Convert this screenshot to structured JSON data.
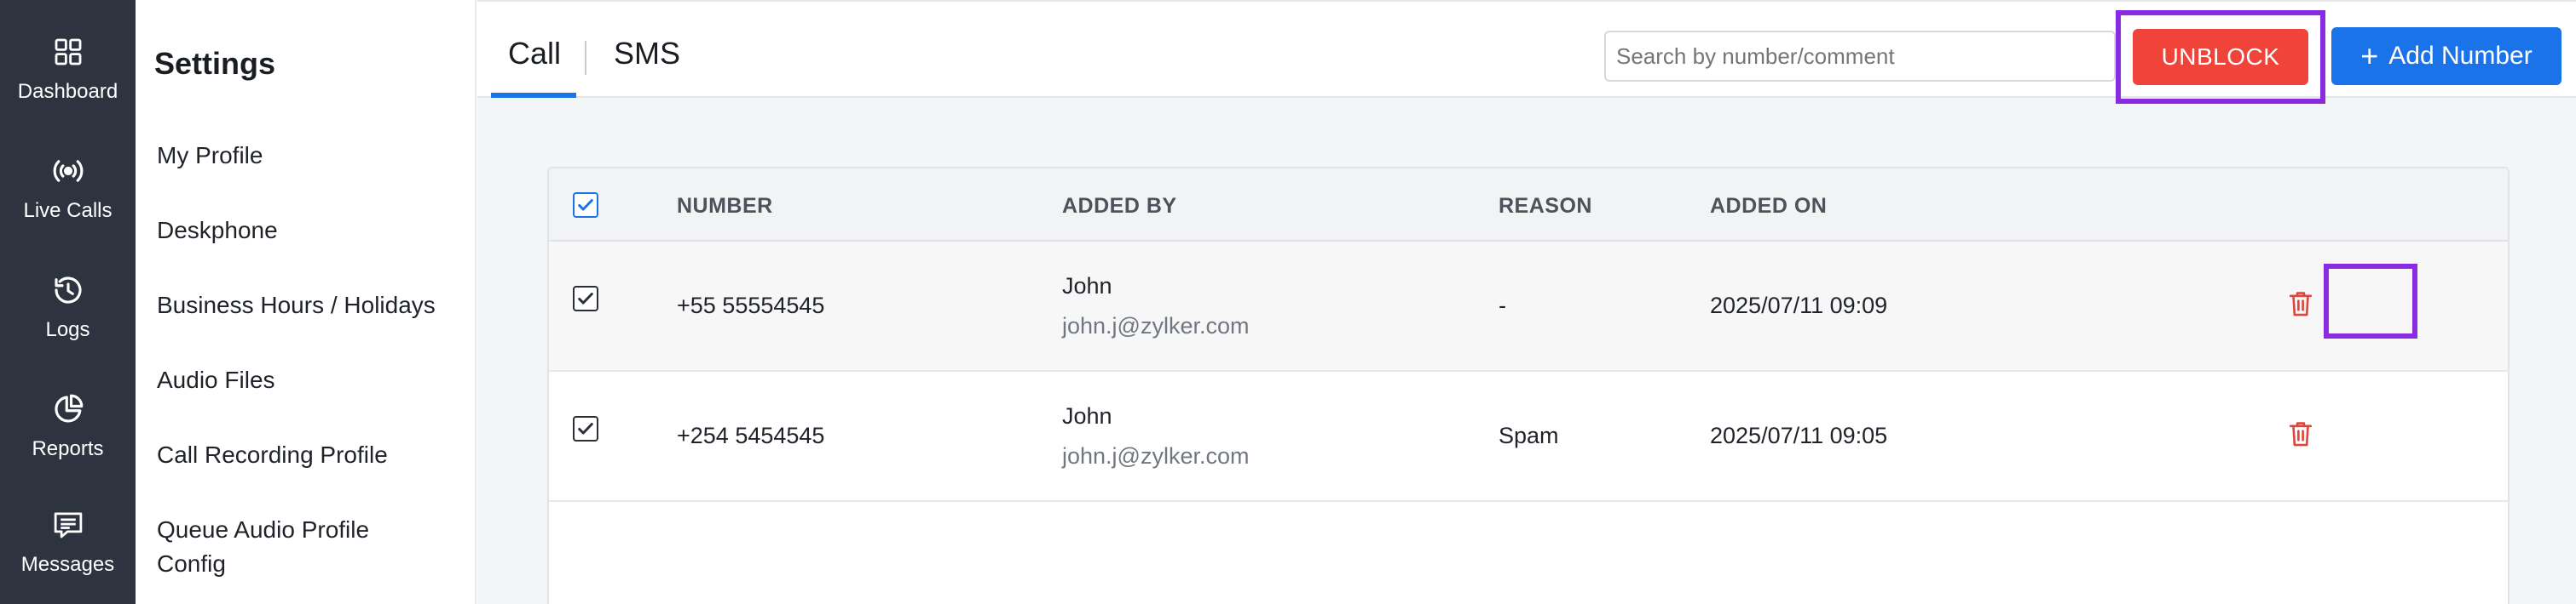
{
  "rail": {
    "items": [
      {
        "label": "Dashboard",
        "icon": "dashboard-grid-icon"
      },
      {
        "label": "Live Calls",
        "icon": "broadcast-icon"
      },
      {
        "label": "Logs",
        "icon": "history-icon"
      },
      {
        "label": "Reports",
        "icon": "pie-chart-icon"
      },
      {
        "label": "Messages",
        "icon": "message-icon"
      }
    ]
  },
  "settings": {
    "title": "Settings",
    "items": [
      {
        "label": "My Profile"
      },
      {
        "label": "Deskphone"
      },
      {
        "label": "Business Hours / Holidays"
      },
      {
        "label": "Audio Files"
      },
      {
        "label": "Call Recording Profile"
      },
      {
        "label": "Queue Audio Profile Config"
      }
    ]
  },
  "tabs": {
    "call": "Call",
    "sms": "SMS",
    "active": "Call"
  },
  "toolbar": {
    "search_placeholder": "Search by number/comment",
    "unblock_label": "UNBLOCK",
    "add_label": "Add Number",
    "add_plus": "+"
  },
  "table": {
    "headers": {
      "number": "NUMBER",
      "added_by": "ADDED BY",
      "reason": "REASON",
      "added_on": "ADDED ON"
    },
    "rows": [
      {
        "checked": true,
        "number": "+55 55554545",
        "added_by_name": "John",
        "added_by_email": "john.j@zylker.com",
        "reason": "-",
        "added_on": "2025/07/11 09:09"
      },
      {
        "checked": true,
        "number": "+254 5454545",
        "added_by_name": "John",
        "added_by_email": "john.j@zylker.com",
        "reason": "Spam",
        "added_on": "2025/07/11 09:05"
      }
    ]
  },
  "colors": {
    "rail_bg": "#2e3340",
    "accent": "#1a73e8",
    "danger": "#f0443a",
    "highlight": "#8a2be2"
  }
}
